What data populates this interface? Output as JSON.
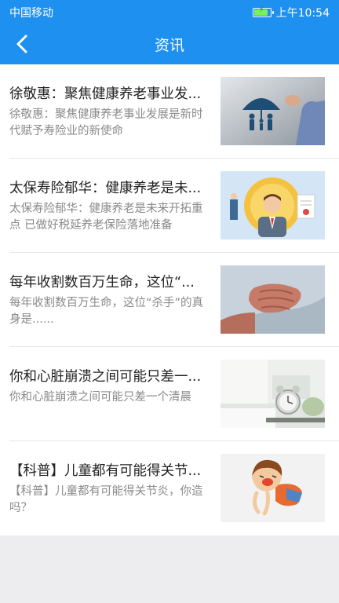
{
  "status_bar": {
    "carrier": "中国移动",
    "time": "上午10:54",
    "battery_level": 0.9
  },
  "nav": {
    "title": "资讯",
    "back_icon": "chevron-left-icon"
  },
  "articles": [
    {
      "title": "徐敬惠：聚焦健康养老事业发...",
      "desc": "徐敬惠：聚焦健康养老事业发展是新时代赋予寿险业的新使命",
      "thumb_icon": "umbrella-family-icon"
    },
    {
      "title": "太保寿险郁华：健康养老是未...",
      "desc": "太保寿险郁华：健康养老是未来开拓重点 已做好税延养老保险落地准备",
      "thumb_icon": "businessman-document-icon"
    },
    {
      "title": "每年收割数百万生命，这位“...",
      "desc": "每年收割数百万生命，这位“杀手”的真身是......",
      "thumb_icon": "chest-pain-icon"
    },
    {
      "title": "你和心脏崩溃之间可能只差一...",
      "desc": "你和心脏崩溃之间可能只差一个清晨",
      "thumb_icon": "alarm-clock-icon"
    },
    {
      "title": "【科普】儿童都有可能得关节...",
      "desc": "【科普】儿童都有可能得关节炎，你造吗？",
      "thumb_icon": "crying-child-icon"
    }
  ],
  "colors": {
    "header": "#1e90f0",
    "title_text": "#222222",
    "desc_text": "#8a8a8a",
    "page_bg": "#ededf0"
  }
}
